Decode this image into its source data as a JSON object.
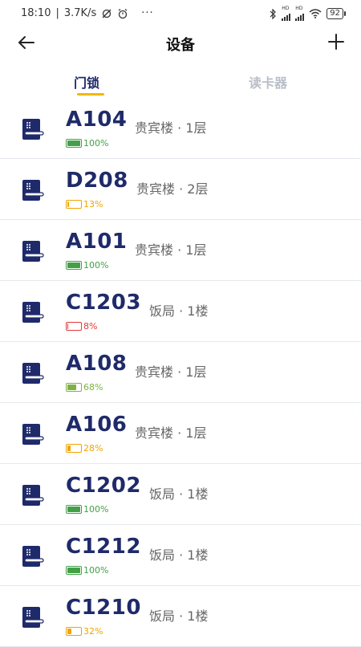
{
  "status_bar": {
    "time": "18:10",
    "network_speed": "3.7K/s",
    "battery": "92",
    "hd1": "HD",
    "hd2": "HD"
  },
  "header": {
    "title": "设备"
  },
  "tabs": [
    {
      "label": "门锁",
      "active": true
    },
    {
      "label": "读卡器",
      "active": false
    }
  ],
  "devices": [
    {
      "name": "A104",
      "location": "贵宾楼 · 1层",
      "battery": "100%",
      "level": 1.0,
      "color": "#43a047"
    },
    {
      "name": "D208",
      "location": "贵宾楼 · 2层",
      "battery": "13%",
      "level": 0.13,
      "color": "#f0a500"
    },
    {
      "name": "A101",
      "location": "贵宾楼 · 1层",
      "battery": "100%",
      "level": 1.0,
      "color": "#43a047"
    },
    {
      "name": "C1203",
      "location": "饭局 · 1楼",
      "battery": "8%",
      "level": 0.08,
      "color": "#e53935"
    },
    {
      "name": "A108",
      "location": "贵宾楼 · 1层",
      "battery": "68%",
      "level": 0.68,
      "color": "#7cb342"
    },
    {
      "name": "A106",
      "location": "贵宾楼 · 1层",
      "battery": "28%",
      "level": 0.28,
      "color": "#f0a500"
    },
    {
      "name": "C1202",
      "location": "饭局 · 1楼",
      "battery": "100%",
      "level": 1.0,
      "color": "#43a047"
    },
    {
      "name": "C1212",
      "location": "饭局 · 1楼",
      "battery": "100%",
      "level": 1.0,
      "color": "#43a047"
    },
    {
      "name": "C1210",
      "location": "饭局 · 1楼",
      "battery": "32%",
      "level": 0.32,
      "color": "#f0a500"
    }
  ],
  "colors": {
    "accent": "#1f2a6a",
    "tab_indicator": "#f2b705"
  }
}
